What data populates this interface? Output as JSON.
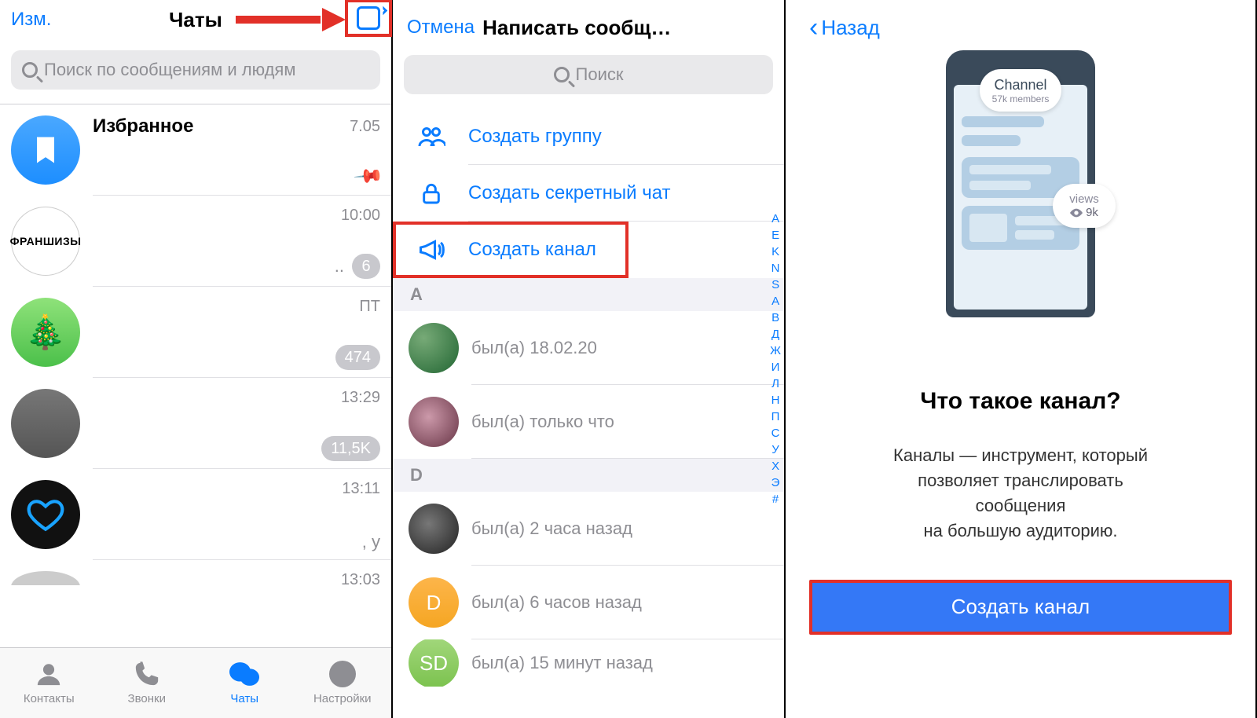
{
  "panel1": {
    "edit": "Изм.",
    "title": "Чаты",
    "search_placeholder": "Поиск по сообщениям и людям",
    "chats": [
      {
        "name": "Избранное",
        "time": "7.05",
        "tail": "",
        "badge": "",
        "pinned": true,
        "avatar": "saved"
      },
      {
        "name": "",
        "time": "10:00",
        "tail": "..",
        "badge": "6",
        "avatar": "fran",
        "avatar_text": "ФРАНШИЗЫ"
      },
      {
        "name": "",
        "time": "ПТ",
        "tail": "",
        "badge": "474",
        "avatar": "green"
      },
      {
        "name": "",
        "time": "13:29",
        "tail": "",
        "badge": "11,5K",
        "avatar": "grey"
      },
      {
        "name": "",
        "time": "13:11",
        "tail": ", у",
        "badge": "",
        "avatar": "heart"
      },
      {
        "name": "",
        "time": "13:03",
        "tail": "",
        "badge": "",
        "avatar": "part"
      }
    ],
    "tabs": [
      {
        "label": "Контакты",
        "icon": "person"
      },
      {
        "label": "Звонки",
        "icon": "phone"
      },
      {
        "label": "Чаты",
        "icon": "chats",
        "active": true
      },
      {
        "label": "Настройки",
        "icon": "gear"
      }
    ]
  },
  "panel2": {
    "cancel": "Отмена",
    "title": "Написать сообщ…",
    "search_placeholder": "Поиск",
    "actions": [
      {
        "label": "Создать группу",
        "icon": "group"
      },
      {
        "label": "Создать секретный чат",
        "icon": "lock"
      },
      {
        "label": "Создать канал",
        "icon": "channel",
        "highlight": true
      }
    ],
    "section_a": "A",
    "section_d": "D",
    "contacts": [
      {
        "status": "был(а) 18.02.20",
        "section": "A",
        "av": "c0"
      },
      {
        "status": "был(а) только что",
        "section": "A",
        "av": "c1"
      },
      {
        "status": "был(а) 2 часа назад",
        "section": "D",
        "av": "c2"
      },
      {
        "status": "был(а) 6 часов назад",
        "section": "D",
        "av": "c3",
        "letter": "D"
      },
      {
        "status": "был(а) 15 минут назад",
        "section": "D",
        "av": "c4",
        "letter": "SD"
      }
    ],
    "index": [
      "A",
      "E",
      "K",
      "N",
      "S",
      "А",
      "В",
      "Д",
      "Ж",
      "И",
      "Л",
      "Н",
      "П",
      "С",
      "У",
      "Х",
      "Э",
      "#"
    ]
  },
  "panel3": {
    "back": "Назад",
    "badge_channel_title": "Channel",
    "badge_channel_sub": "57k members",
    "badge_views_label": "views",
    "badge_views_value": "9k",
    "heading": "Что такое канал?",
    "body_l1": "Каналы — инструмент, который",
    "body_l2": "позволяет транслировать",
    "body_l3": "сообщения",
    "body_l4": "на большую аудиторию.",
    "button": "Создать канал"
  }
}
